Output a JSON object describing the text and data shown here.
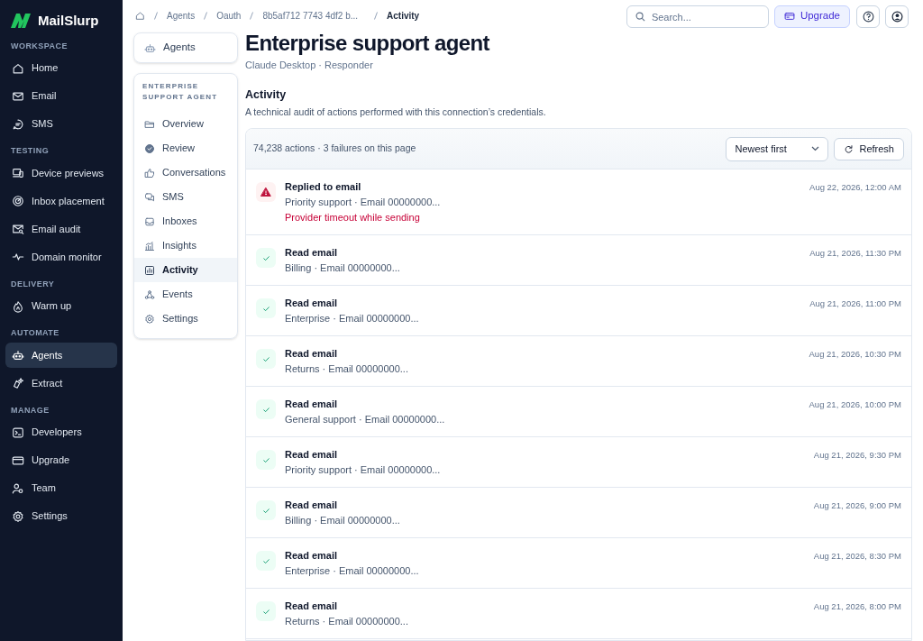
{
  "brand": "MailSlurp",
  "sidebar": {
    "sections": [
      {
        "title": "WORKSPACE",
        "items": [
          {
            "label": "Home",
            "selected": false
          },
          {
            "label": "Email",
            "selected": false
          },
          {
            "label": "SMS",
            "selected": false
          }
        ]
      },
      {
        "title": "TESTING",
        "items": [
          {
            "label": "Device previews",
            "selected": false
          },
          {
            "label": "Inbox placement",
            "selected": false
          },
          {
            "label": "Email audit",
            "selected": false
          },
          {
            "label": "Domain monitor",
            "selected": false
          }
        ]
      },
      {
        "title": "DELIVERY",
        "items": [
          {
            "label": "Warm up",
            "selected": false
          }
        ]
      },
      {
        "title": "AUTOMATE",
        "items": [
          {
            "label": "Agents",
            "selected": true
          },
          {
            "label": "Extract",
            "selected": false
          }
        ]
      },
      {
        "title": "MANAGE",
        "items": [
          {
            "label": "Developers",
            "selected": false
          },
          {
            "label": "Upgrade",
            "selected": false
          },
          {
            "label": "Team",
            "selected": false
          },
          {
            "label": "Settings",
            "selected": false
          }
        ]
      }
    ]
  },
  "breadcrumb": [
    "Agents",
    "Oauth",
    "8b5af712 7743 4df2 b...",
    "Activity"
  ],
  "search": {
    "placeholder": "Search..."
  },
  "upgrade_button": "Upgrade",
  "back_link": "Agents",
  "subnav": {
    "title": "ENTERPRISE SUPPORT AGENT",
    "items": [
      {
        "label": "Overview",
        "selected": false
      },
      {
        "label": "Review",
        "selected": false
      },
      {
        "label": "Conversations",
        "selected": false
      },
      {
        "label": "SMS",
        "selected": false
      },
      {
        "label": "Inboxes",
        "selected": false
      },
      {
        "label": "Insights",
        "selected": false
      },
      {
        "label": "Activity",
        "selected": true
      },
      {
        "label": "Events",
        "selected": false
      },
      {
        "label": "Settings",
        "selected": false
      }
    ]
  },
  "page": {
    "title": "Enterprise support agent",
    "subtitle": "Claude Desktop · Responder"
  },
  "activity": {
    "title": "Activity",
    "description": "A technical audit of actions performed with this connection’s credentials.",
    "summary": "74,238 actions · 3 failures on this page",
    "sort": "Newest first",
    "refresh": "Refresh",
    "rows": [
      {
        "kind": "failure",
        "title": "Replied to email",
        "detail": "Priority support · Email 00000000...",
        "error": "Provider timeout while sending",
        "time": "Aug 22, 2026, 12:00 AM"
      },
      {
        "kind": "success",
        "title": "Read email",
        "detail": "Billing · Email 00000000...",
        "time": "Aug 21, 2026, 11:30 PM"
      },
      {
        "kind": "success",
        "title": "Read email",
        "detail": "Enterprise · Email 00000000...",
        "time": "Aug 21, 2026, 11:00 PM"
      },
      {
        "kind": "success",
        "title": "Read email",
        "detail": "Returns · Email 00000000...",
        "time": "Aug 21, 2026, 10:30 PM"
      },
      {
        "kind": "success",
        "title": "Read email",
        "detail": "General support · Email 00000000...",
        "time": "Aug 21, 2026, 10:00 PM"
      },
      {
        "kind": "success",
        "title": "Read email",
        "detail": "Priority support · Email 00000000...",
        "time": "Aug 21, 2026, 9:30 PM"
      },
      {
        "kind": "success",
        "title": "Read email",
        "detail": "Billing · Email 00000000...",
        "time": "Aug 21, 2026, 9:00 PM"
      },
      {
        "kind": "success",
        "title": "Read email",
        "detail": "Enterprise · Email 00000000...",
        "time": "Aug 21, 2026, 8:30 PM"
      },
      {
        "kind": "success",
        "title": "Read email",
        "detail": "Returns · Email 00000000...",
        "time": "Aug 21, 2026, 8:00 PM"
      }
    ]
  }
}
